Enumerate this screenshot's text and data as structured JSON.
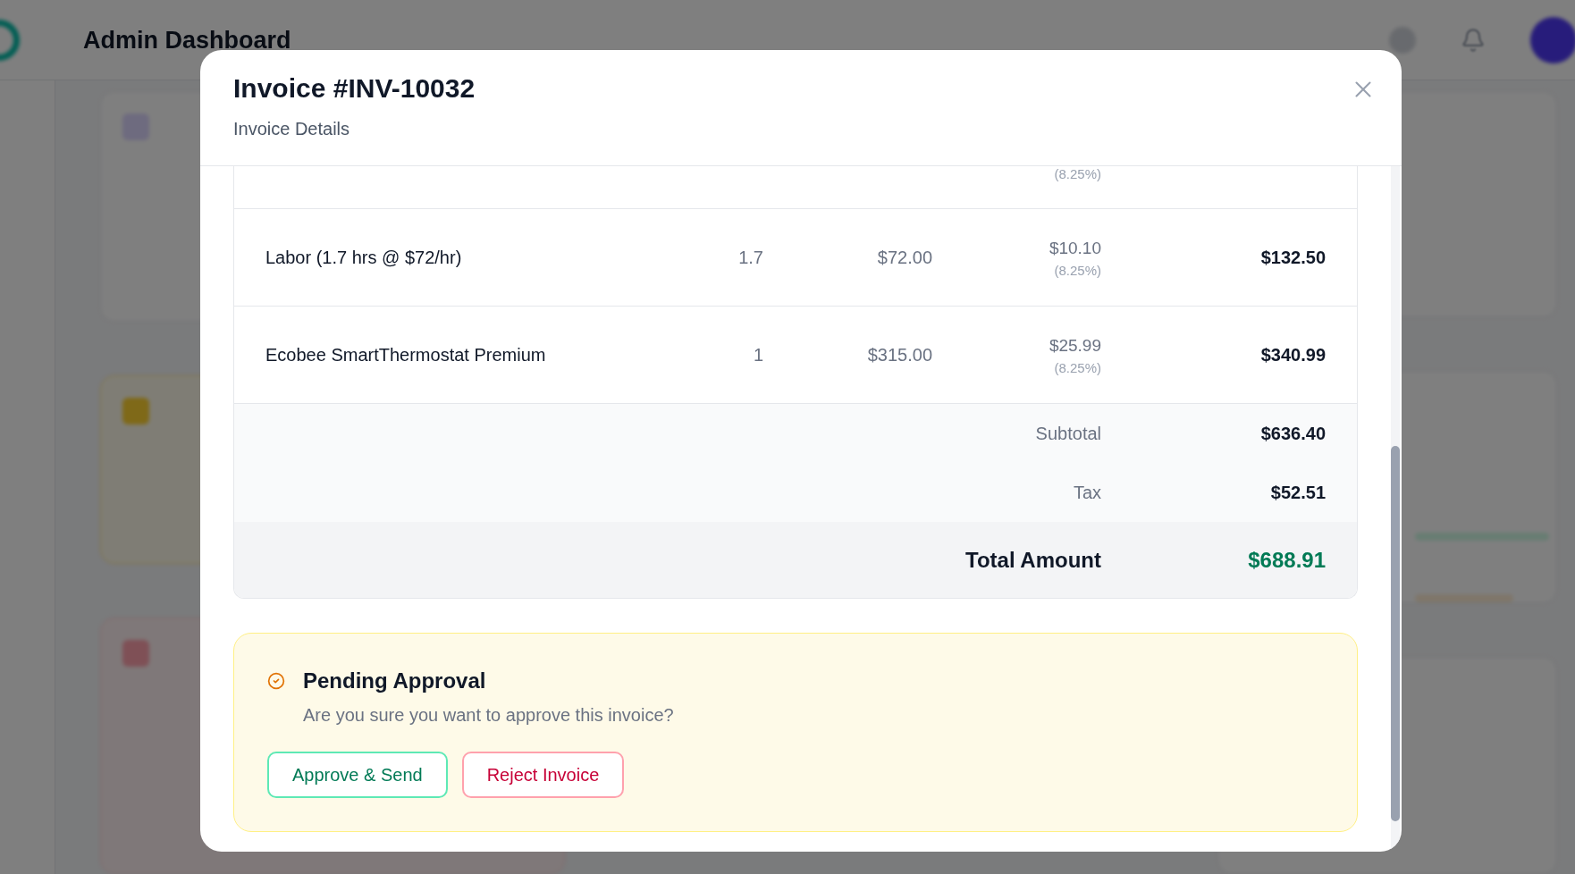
{
  "background": {
    "title": "Admin Dashboard"
  },
  "modal": {
    "title": "Invoice #INV-10032",
    "subtitle": "Invoice Details"
  },
  "partial_row": {
    "tax_rate": "(8.25%)"
  },
  "line_items": [
    {
      "description": "Labor (1.7 hrs @ $72/hr)",
      "quantity": "1.7",
      "unit_price": "$72.00",
      "tax": "$10.10",
      "tax_rate": "(8.25%)",
      "total": "$132.50"
    },
    {
      "description": "Ecobee SmartThermostat Premium",
      "quantity": "1",
      "unit_price": "$315.00",
      "tax": "$25.99",
      "tax_rate": "(8.25%)",
      "total": "$340.99"
    }
  ],
  "summary": [
    {
      "label": "Subtotal",
      "value": "$636.40"
    },
    {
      "label": "Tax",
      "value": "$52.51"
    }
  ],
  "total": {
    "label": "Total Amount",
    "value": "$688.91"
  },
  "approval": {
    "title": "Pending Approval",
    "message": "Are you sure you want to approve this invoice?",
    "buttons": [
      {
        "label": "Approve & Send",
        "kind": "approve"
      },
      {
        "label": "Reject Invoice",
        "kind": "reject"
      }
    ]
  }
}
